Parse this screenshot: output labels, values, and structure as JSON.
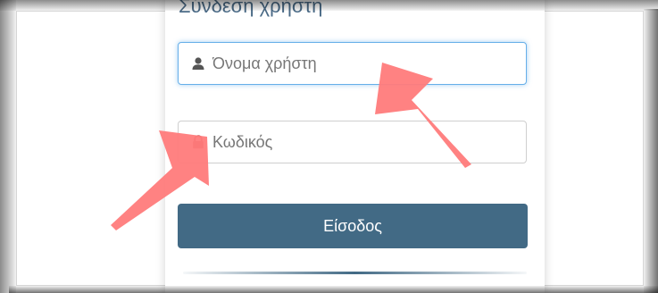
{
  "login": {
    "title": "Σύνδεση χρήστη",
    "username": {
      "placeholder": "Όνομα χρήστη",
      "value": "",
      "icon": "user-icon"
    },
    "password": {
      "placeholder": "Κωδικός",
      "value": "",
      "icon": "lock-icon"
    },
    "submit_label": "Είσοδος"
  },
  "colors": {
    "button": "#426a85",
    "focus_border": "#66afe9",
    "arrow": "#ff7b7b",
    "lock_icon": "#b23a3a",
    "user_icon": "#555555"
  }
}
